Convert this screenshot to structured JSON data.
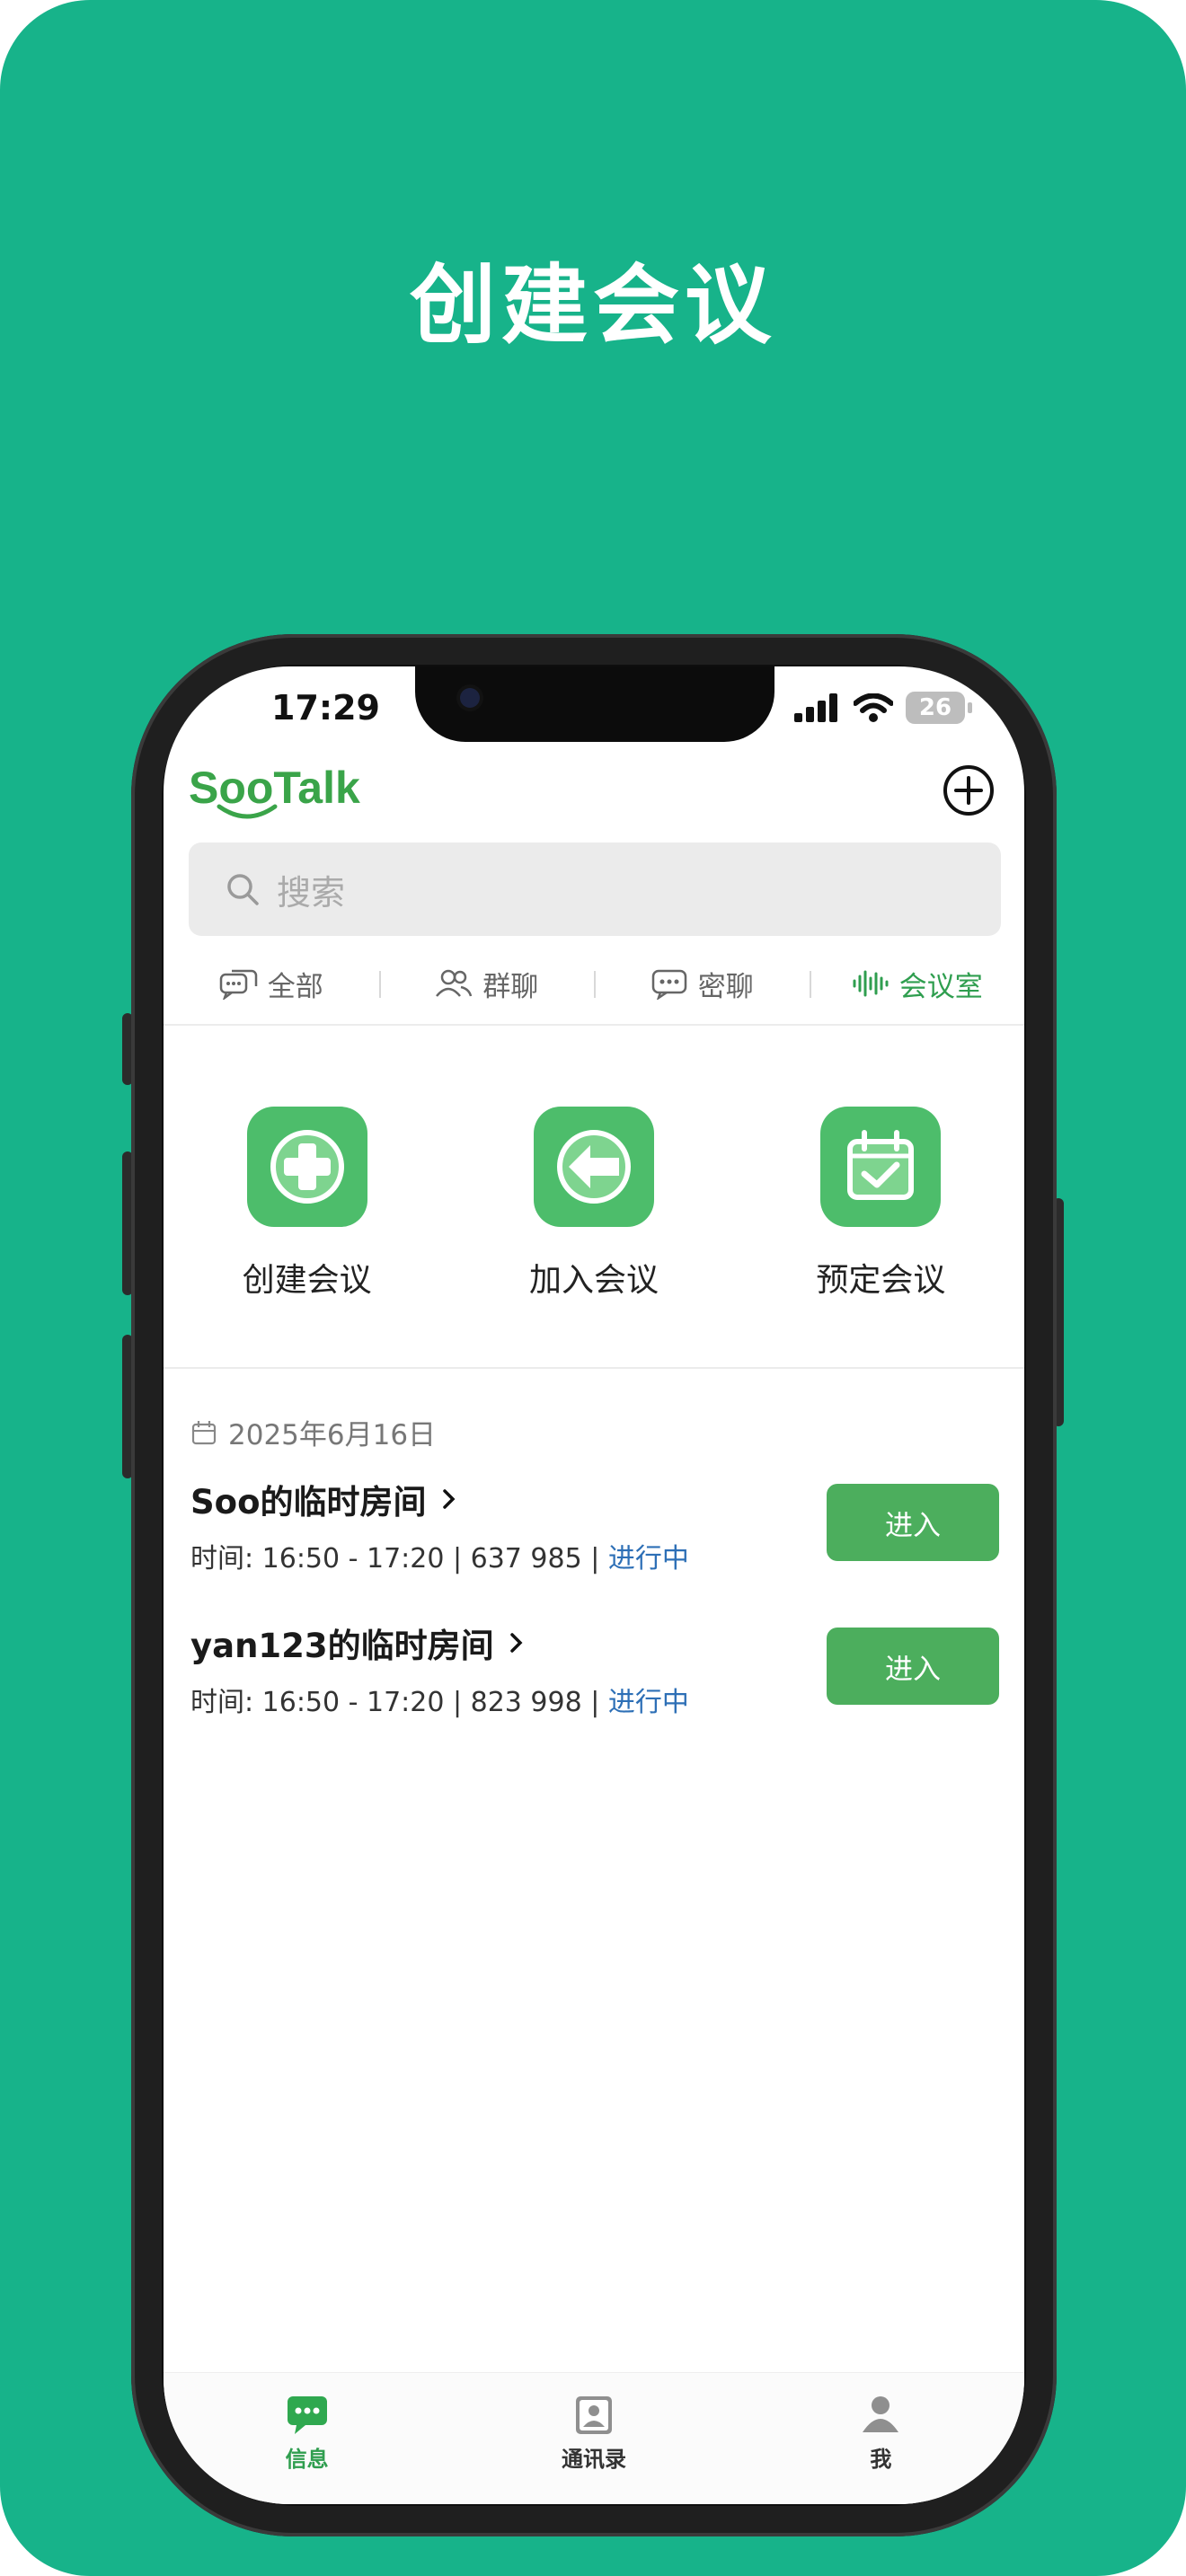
{
  "hero": {
    "title": "创建会议"
  },
  "status_bar": {
    "time": "17:29",
    "battery": "26"
  },
  "header": {
    "logo_text": "SooTalk"
  },
  "search": {
    "placeholder": "搜索"
  },
  "filter_tabs": [
    {
      "label": "全部",
      "icon": "chat-bubbles-icon",
      "active": false
    },
    {
      "label": "群聊",
      "icon": "group-icon",
      "active": false
    },
    {
      "label": "密聊",
      "icon": "secret-chat-icon",
      "active": false
    },
    {
      "label": "会议室",
      "icon": "soundwave-icon",
      "active": true
    }
  ],
  "actions": [
    {
      "label": "创建会议",
      "icon": "plus-circle-icon"
    },
    {
      "label": "加入会议",
      "icon": "arrow-left-circle-icon"
    },
    {
      "label": "预定会议",
      "icon": "calendar-check-icon"
    }
  ],
  "meeting_list": {
    "date": "2025年6月16日",
    "rooms": [
      {
        "name": "Soo的临时房间",
        "meta": "时间: 16:50 - 17:20 | 637 985 | ",
        "status": "进行中",
        "button": "进入"
      },
      {
        "name": "yan123的临时房间",
        "meta": "时间: 16:50 - 17:20 | 823 998 | ",
        "status": "进行中",
        "button": "进入"
      }
    ]
  },
  "bottom_tabs": [
    {
      "label": "信息",
      "icon": "message-icon",
      "active": true
    },
    {
      "label": "通讯录",
      "icon": "contacts-icon",
      "active": false
    },
    {
      "label": "我",
      "icon": "person-icon",
      "active": false
    }
  ],
  "colors": {
    "background": "#17b38a",
    "accent": "#4cae5d",
    "live": "#2d6fb6"
  }
}
